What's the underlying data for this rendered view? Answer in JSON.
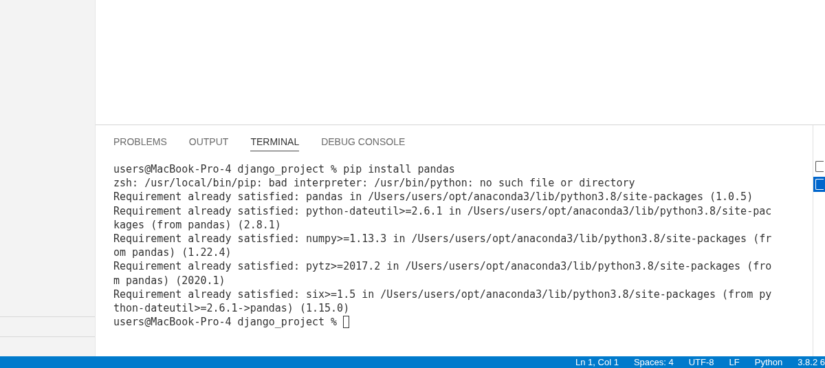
{
  "panel_tabs": [
    {
      "label": "PROBLEMS",
      "selected": false
    },
    {
      "label": "OUTPUT",
      "selected": false
    },
    {
      "label": "TERMINAL",
      "selected": true
    },
    {
      "label": "DEBUG CONSOLE",
      "selected": false
    }
  ],
  "terminal_lines": [
    "users@MacBook-Pro-4 django_project % pip install pandas",
    "zsh: /usr/local/bin/pip: bad interpreter: /usr/bin/python: no such file or directory",
    "Requirement already satisfied: pandas in /Users/users/opt/anaconda3/lib/python3.8/site-packages (1.0.5)",
    "Requirement already satisfied: python-dateutil>=2.6.1 in /Users/users/opt/anaconda3/lib/python3.8/site-pac",
    "kages (from pandas) (2.8.1)",
    "Requirement already satisfied: numpy>=1.13.3 in /Users/users/opt/anaconda3/lib/python3.8/site-packages (fr",
    "om pandas) (1.22.4)",
    "Requirement already satisfied: pytz>=2017.2 in /Users/users/opt/anaconda3/lib/python3.8/site-packages (fro",
    "m pandas) (2020.1)",
    "Requirement already satisfied: six>=1.5 in /Users/users/opt/anaconda3/lib/python3.8/site-packages (from py",
    "thon-dateutil>=2.6.1->pandas) (1.15.0)"
  ],
  "prompt": "users@MacBook-Pro-4 django_project %",
  "terminal_instances": [
    {
      "selected": false
    },
    {
      "selected": true
    }
  ],
  "status_bar": [
    "Ln 1, Col 1",
    "Spaces: 4",
    "UTF-8",
    "LF",
    "Python",
    "3.8.2 6"
  ]
}
